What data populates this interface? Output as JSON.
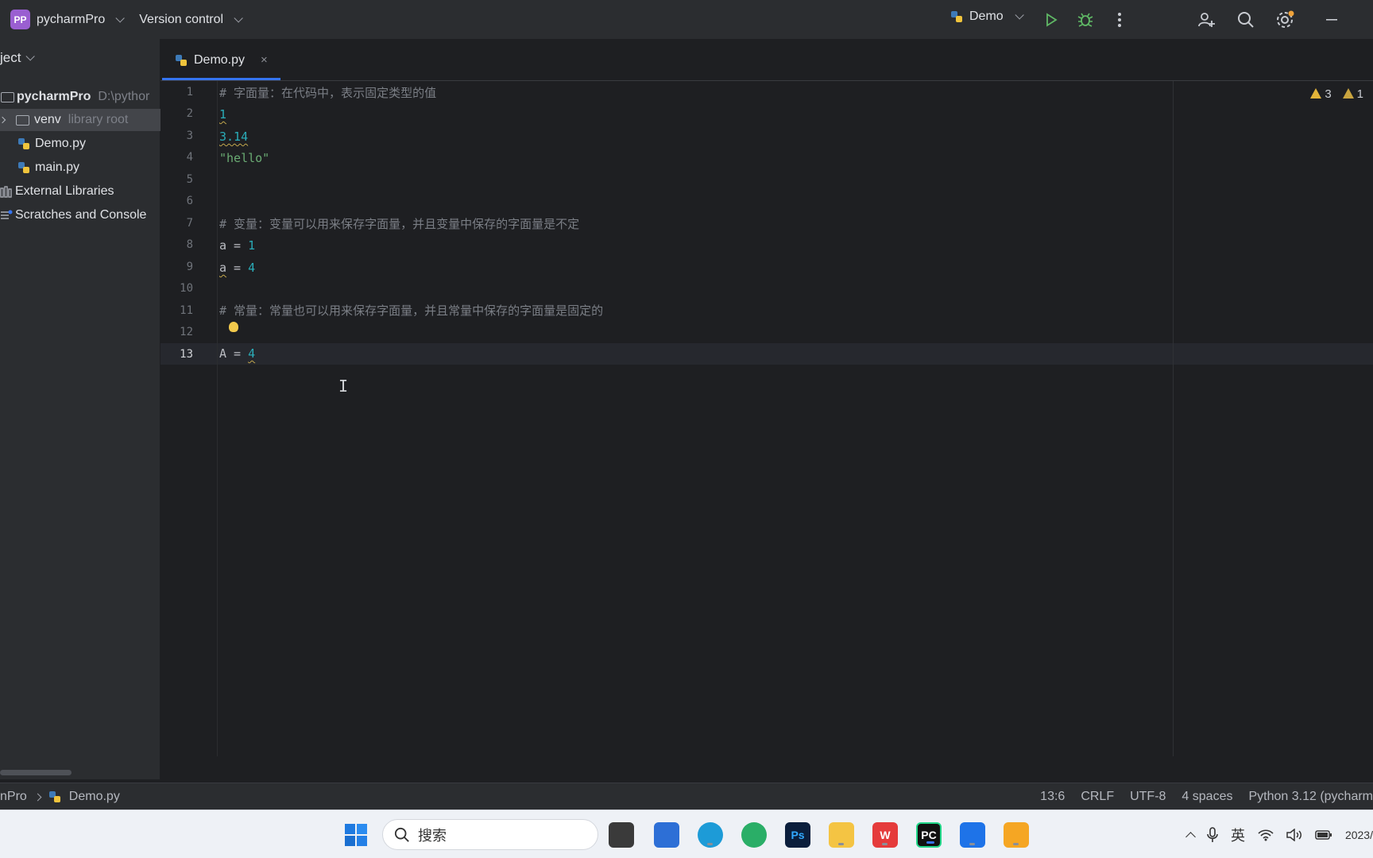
{
  "titlebar": {
    "project_badge": "PP",
    "project_name": "pycharmPro",
    "vcs_label": "Version control",
    "run_config": "Demo"
  },
  "project_panel": {
    "header": "ject",
    "items": [
      {
        "label": "pycharmPro",
        "muted": "D:\\pythor"
      },
      {
        "label": "venv",
        "muted": "library root"
      },
      {
        "label": "Demo.py"
      },
      {
        "label": "main.py"
      },
      {
        "label": "External Libraries"
      },
      {
        "label": "Scratches and Console"
      }
    ]
  },
  "editor": {
    "tab_label": "Demo.py",
    "tab_close": "×",
    "inspections": {
      "warnings": "3",
      "weak_warnings": "1"
    },
    "line_numbers": [
      "1",
      "2",
      "3",
      "4",
      "5",
      "6",
      "7",
      "8",
      "9",
      "10",
      "11",
      "12",
      "13"
    ],
    "current_line": "13",
    "lines": {
      "l1": "# 字面量：在代码中，表示固定类型的值",
      "l2": "1",
      "l3": "3.14",
      "l4": "\"hello\"",
      "l7": "# 变量：变量可以用来保存字面量，并且变量中保存的字面量是不定",
      "l8_name": "a",
      "l8_op": " = ",
      "l8_val": "1",
      "l9_name": "a",
      "l9_op": " = ",
      "l9_val": "4",
      "l12": "# 常量：常量也可以用来保存字面量，并且常量中保存的字面量是固定的",
      "l13_name": "A",
      "l13_op": " = ",
      "l13_val": "4"
    }
  },
  "statusbar": {
    "breadcrumb_project": "nPro",
    "breadcrumb_file": "Demo.py",
    "position": "13:6",
    "line_sep": "CRLF",
    "encoding": "UTF-8",
    "indent": "4 spaces",
    "interpreter": "Python 3.12 (pycharm"
  },
  "taskbar": {
    "search_placeholder": "搜索",
    "ime": "英",
    "clock": "2023/"
  }
}
